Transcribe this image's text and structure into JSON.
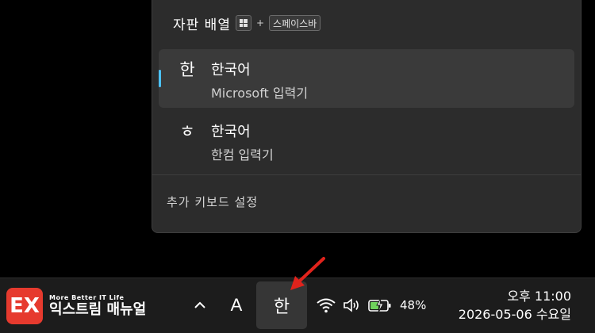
{
  "flyout": {
    "title": "자판 배열",
    "shortcut_plus": "+",
    "shortcut_key": "스페이스바",
    "items": [
      {
        "glyph": "한",
        "name": "한국어",
        "sub": "Microsoft 입력기",
        "selected": true
      },
      {
        "glyph": "ㅎ",
        "name": "한국어",
        "sub": "한컴 입력기",
        "selected": false
      }
    ],
    "more_settings": "추가 키보드 설정",
    "accent_color": "#4cc2ff"
  },
  "taskbar": {
    "logo": {
      "small": "More Better IT Life",
      "big": "익스트림 매뉴얼",
      "mark": "EX",
      "color": "#e63a2e"
    },
    "chevron_icon": "^",
    "alpha_label": "A",
    "ime_label": "한",
    "battery_percent": "48%",
    "time": "오후 11:00",
    "date": "2026-05-06 수요일"
  },
  "annotation": {
    "arrow_color": "#e0231c"
  }
}
